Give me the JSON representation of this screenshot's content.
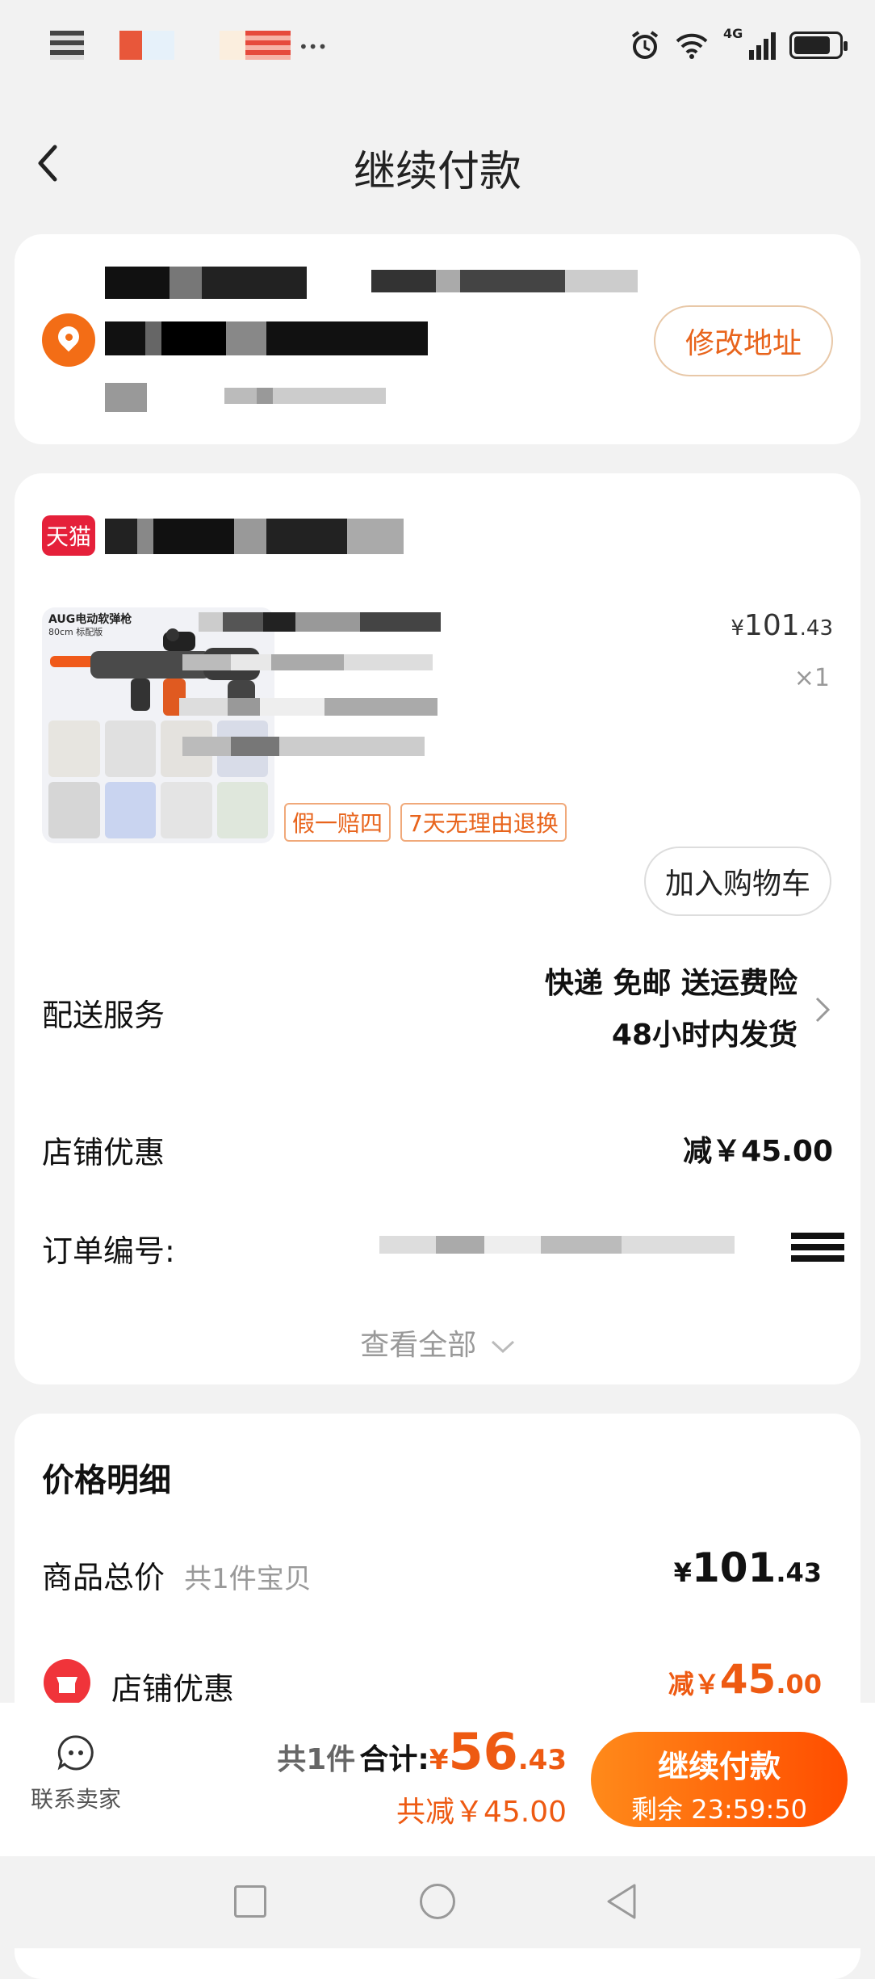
{
  "status_bar": {
    "network": "4G"
  },
  "header": {
    "title": "继续付款"
  },
  "address": {
    "edit_button": "修改地址"
  },
  "order": {
    "shop_badge": "天猫",
    "product": {
      "image_caption": "AUG电动软弹枪",
      "image_subcaption": "80cm 标配版",
      "price_main": "101",
      "price_decimal": ".43",
      "quantity": "×1",
      "tags": [
        "假一赔四",
        "7天无理由退换"
      ],
      "add_to_cart": "加入购物车"
    },
    "delivery": {
      "label": "配送服务",
      "line1": "快递 免邮 送运费险",
      "line2": "48小时内发货"
    },
    "shop_discount": {
      "label": "店铺优惠",
      "value": "减￥45.00"
    },
    "order_no": {
      "label": "订单编号:"
    },
    "view_all": "查看全部"
  },
  "price_detail": {
    "title": "价格明细",
    "goods_total": {
      "label": "商品总价",
      "sub": "共1件宝贝",
      "currency": "¥",
      "main": "101",
      "decimal": ".43"
    },
    "shop_discount": {
      "label": "店铺优惠",
      "prefix": "减￥",
      "main": "45",
      "decimal": ".00"
    }
  },
  "bottom_bar": {
    "contact_label": "联系卖家",
    "count": "共1件",
    "total_label": "合计:",
    "total_currency": "¥",
    "total_main": "56",
    "total_decimal": ".43",
    "saved": "共减￥45.00",
    "pay_button": "继续付款",
    "countdown": "剩余 23:59:50"
  },
  "colors": {
    "accent": "#ee5a12",
    "tmall": "#e5203a",
    "background": "#f2f2f2"
  }
}
